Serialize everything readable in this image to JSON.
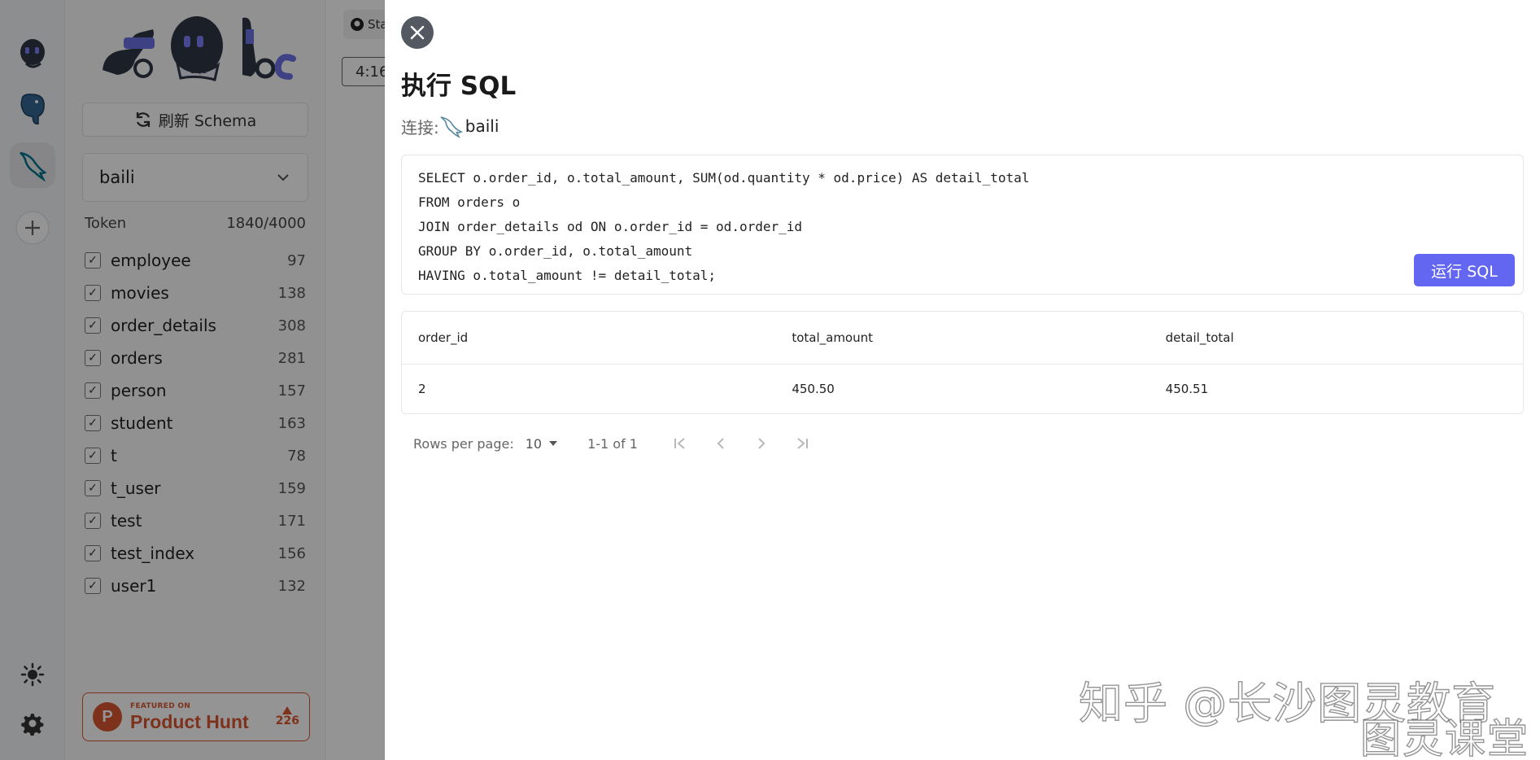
{
  "rail": {
    "icons": [
      "chatdb-robot-icon",
      "postgresql-elephant-icon",
      "mysql-dolphin-icon",
      "add-icon"
    ],
    "bottom_icons": [
      "theme-sun-icon",
      "settings-gear-icon"
    ]
  },
  "sidebar": {
    "refresh_label": "刷新 Schema",
    "selected_db": "baili",
    "token_label": "Token",
    "token_value": "1840/4000",
    "tables": [
      {
        "name": "employee",
        "count": "97"
      },
      {
        "name": "movies",
        "count": "138"
      },
      {
        "name": "order_details",
        "count": "308"
      },
      {
        "name": "orders",
        "count": "281"
      },
      {
        "name": "person",
        "count": "157"
      },
      {
        "name": "student",
        "count": "163"
      },
      {
        "name": "t",
        "count": "78"
      },
      {
        "name": "t_user",
        "count": "159"
      },
      {
        "name": "test",
        "count": "171"
      },
      {
        "name": "test_index",
        "count": "156"
      },
      {
        "name": "user1",
        "count": "132"
      }
    ],
    "product_hunt": {
      "featured": "FEATURED ON",
      "name": "Product Hunt",
      "votes": "226"
    }
  },
  "main": {
    "github_label": "Sta",
    "time_label": "4:16"
  },
  "dialog": {
    "title": "执行 SQL",
    "connection_label": "连接:",
    "connection_name": "baili",
    "sql_lines": [
      "SELECT o.order_id, o.total_amount, SUM(od.quantity * od.price) AS detail_total",
      "FROM orders o",
      "JOIN order_details od ON o.order_id = od.order_id",
      "GROUP BY o.order_id, o.total_amount",
      "HAVING o.total_amount != detail_total;"
    ],
    "run_label": "运行 SQL",
    "result": {
      "columns": [
        "order_id",
        "total_amount",
        "detail_total"
      ],
      "rows": [
        [
          "2",
          "450.50",
          "450.51"
        ]
      ]
    },
    "pagination": {
      "rows_per_page_label": "Rows per page:",
      "rows_per_page_value": "10",
      "range": "1-1 of 1"
    }
  },
  "watermark": {
    "line1": "知乎 @长沙图灵教育",
    "line2": "图灵课堂"
  },
  "colors": {
    "accent": "#6366f1",
    "product_hunt": "#da552f",
    "overlay": "rgba(0,0,0,0.42)"
  }
}
